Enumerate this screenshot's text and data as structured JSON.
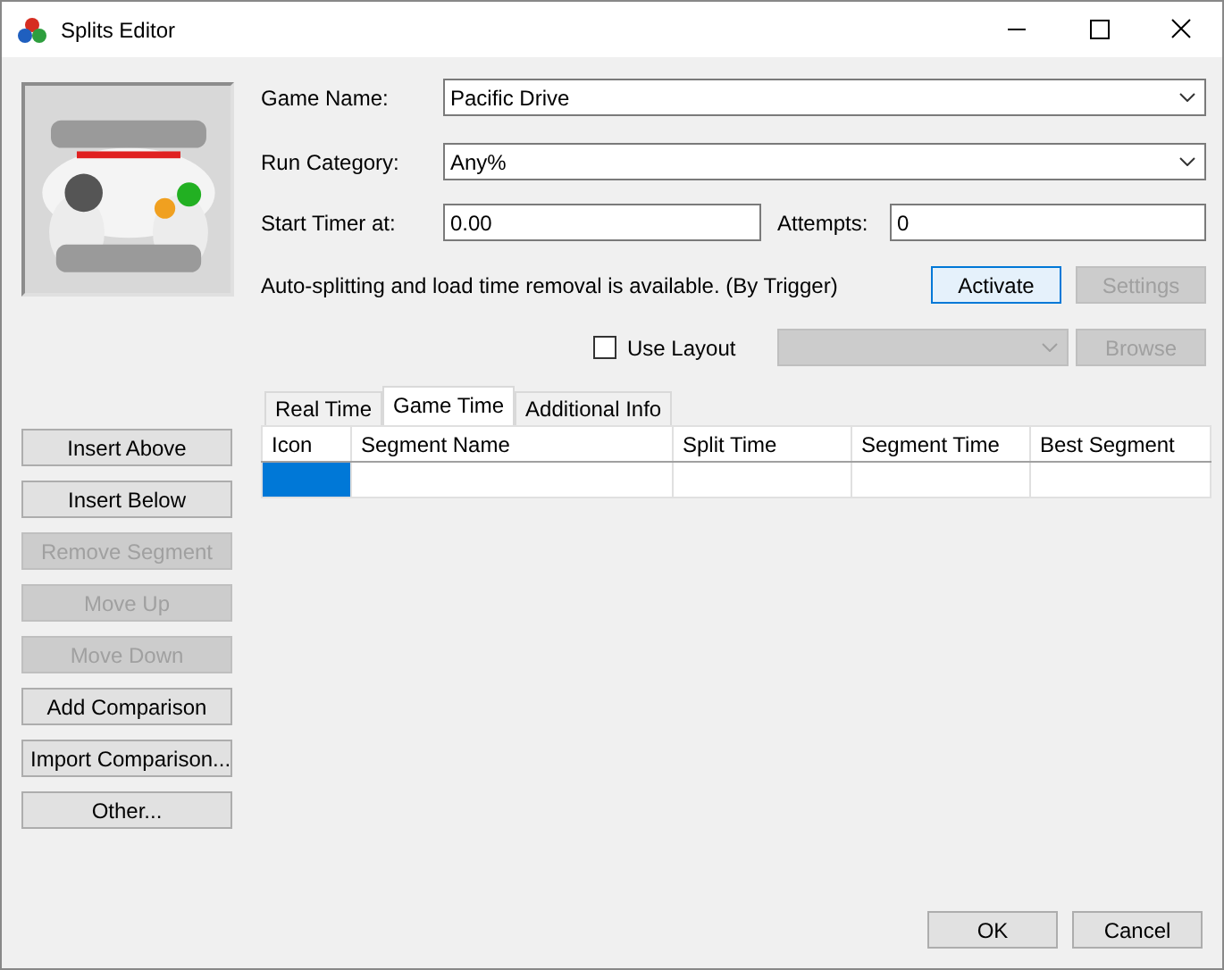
{
  "window": {
    "title": "Splits Editor"
  },
  "game_name": {
    "label": "Game Name:",
    "value": "Pacific Drive"
  },
  "run_category": {
    "label": "Run Category:",
    "value": "Any%"
  },
  "start_timer": {
    "label": "Start Timer at:",
    "value": "0.00"
  },
  "attempts": {
    "label": "Attempts:",
    "value": "0"
  },
  "autosplit": {
    "text": "Auto-splitting and load time removal is available. (By Trigger)",
    "buttons": [
      {
        "label": "Activate",
        "disabled": false,
        "focused": true
      },
      {
        "label": "Settings",
        "disabled": true,
        "focused": false
      }
    ]
  },
  "use_layout": {
    "label": "Use Layout",
    "checked": false
  },
  "layout_combo": {
    "disabled": true
  },
  "browse": {
    "label": "Browse",
    "disabled": true
  },
  "tabs": [
    {
      "label": "Real Time",
      "selected": false
    },
    {
      "label": "Game Time",
      "selected": true
    },
    {
      "label": "Additional Info",
      "selected": false
    }
  ],
  "table": {
    "columns": [
      "Icon",
      "Segment Name",
      "Split Time",
      "Segment Time",
      "Best Segment"
    ],
    "rows": [
      {
        "selected": true
      }
    ]
  },
  "side_buttons": [
    {
      "label": "Insert Above",
      "disabled": false
    },
    {
      "label": "Insert Below",
      "disabled": false
    },
    {
      "label": "Remove Segment",
      "disabled": true
    },
    {
      "label": "Move Up",
      "disabled": true
    },
    {
      "label": "Move Down",
      "disabled": true
    },
    {
      "label": "Add Comparison",
      "disabled": false
    },
    {
      "label": "Import Comparison...",
      "disabled": false
    },
    {
      "label": "Other...",
      "disabled": false
    }
  ],
  "footer_buttons": [
    {
      "label": "OK",
      "disabled": false
    },
    {
      "label": "Cancel",
      "disabled": false
    }
  ]
}
